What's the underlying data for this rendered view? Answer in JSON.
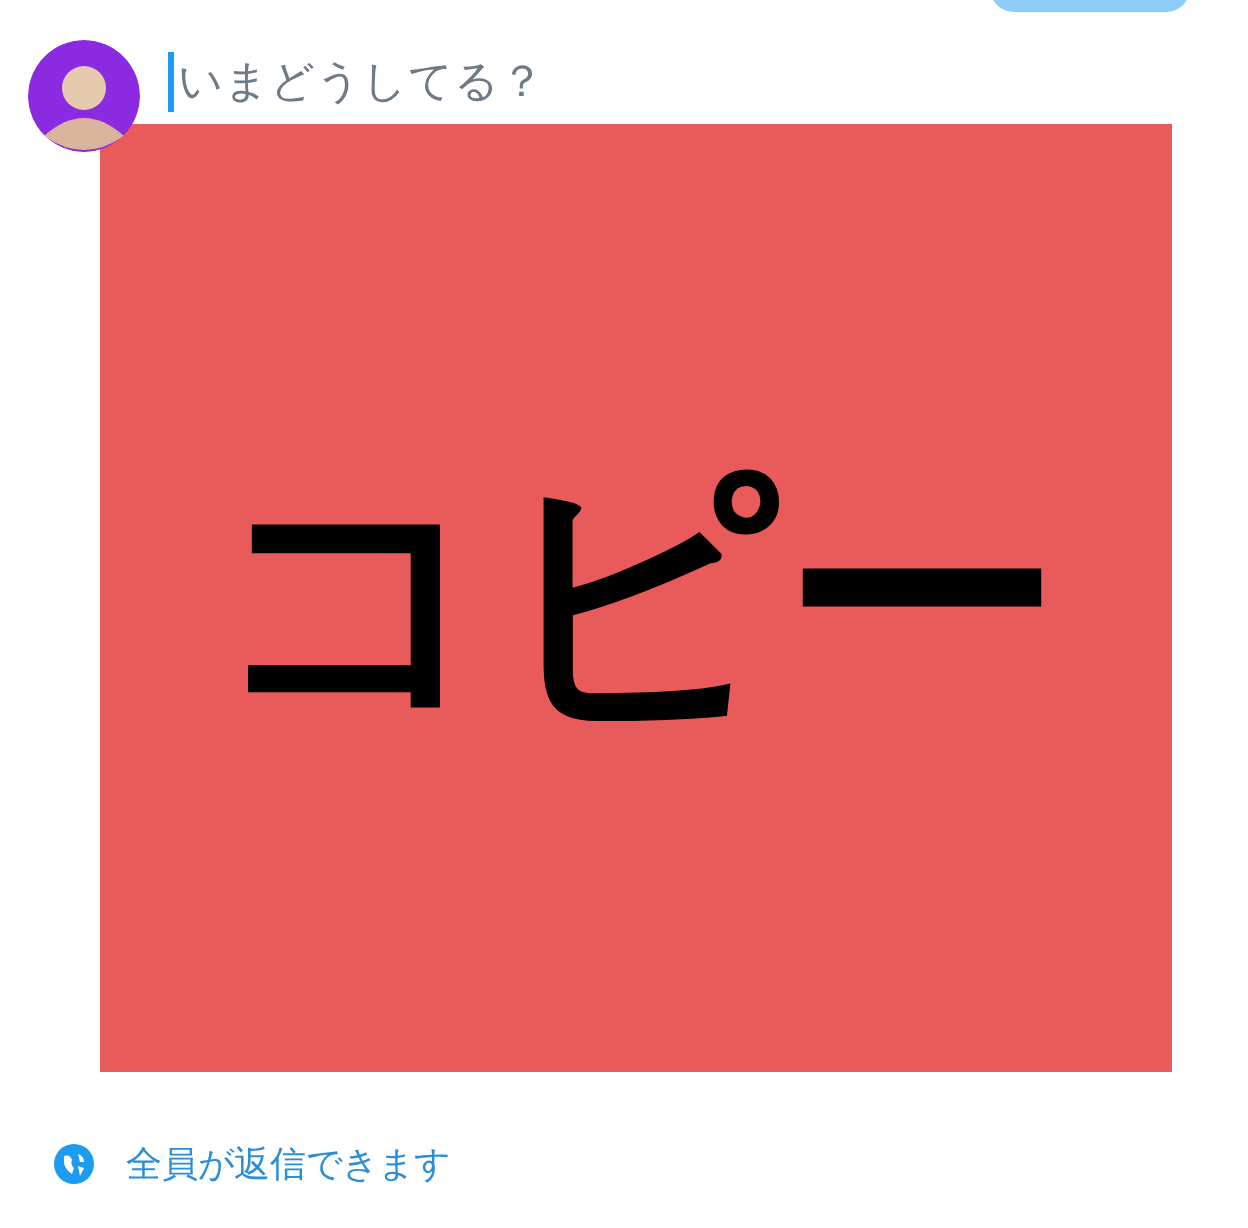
{
  "composer": {
    "placeholder": "いまどうしてる？"
  },
  "attachment": {
    "text": "コピー"
  },
  "reply_setting": {
    "label": "全員が返信できます"
  }
}
